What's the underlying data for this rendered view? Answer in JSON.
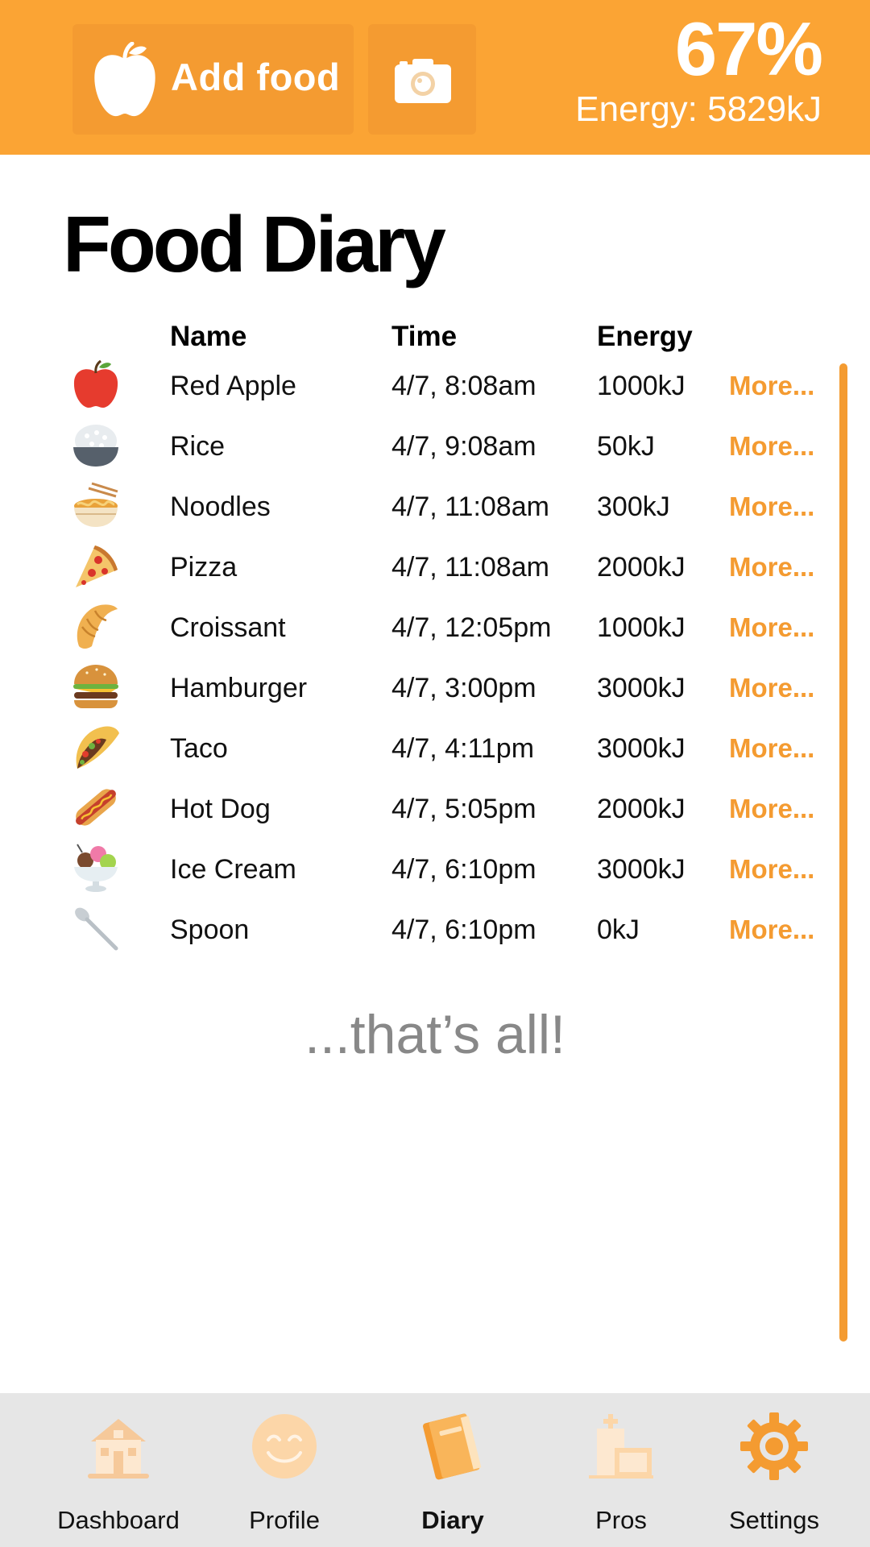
{
  "header": {
    "add_food_label": "Add food",
    "percent": "67%",
    "energy_total": "Energy: 5829kJ",
    "colors": {
      "bar": "#fba434",
      "button": "#f49b31"
    }
  },
  "page_title": "Food Diary",
  "table": {
    "columns": [
      "Name",
      "Time",
      "Energy"
    ],
    "rows": [
      {
        "icon": "red-apple-icon",
        "name": "Red Apple",
        "time": "4/7, 8:08am",
        "energy": "1000kJ",
        "more": "More..."
      },
      {
        "icon": "rice-bowl-icon",
        "name": "Rice",
        "time": "4/7, 9:08am",
        "energy": "50kJ",
        "more": "More..."
      },
      {
        "icon": "noodles-icon",
        "name": "Noodles",
        "time": "4/7, 11:08am",
        "energy": "300kJ",
        "more": "More..."
      },
      {
        "icon": "pizza-icon",
        "name": "Pizza",
        "time": "4/7, 11:08am",
        "energy": "2000kJ",
        "more": "More..."
      },
      {
        "icon": "croissant-icon",
        "name": "Croissant",
        "time": "4/7, 12:05pm",
        "energy": "1000kJ",
        "more": "More..."
      },
      {
        "icon": "hamburger-icon",
        "name": "Hamburger",
        "time": "4/7, 3:00pm",
        "energy": "3000kJ",
        "more": "More..."
      },
      {
        "icon": "taco-icon",
        "name": "Taco",
        "time": "4/7, 4:11pm",
        "energy": "3000kJ",
        "more": "More..."
      },
      {
        "icon": "hot-dog-icon",
        "name": "Hot Dog",
        "time": "4/7, 5:05pm",
        "energy": "2000kJ",
        "more": "More..."
      },
      {
        "icon": "ice-cream-icon",
        "name": "Ice Cream",
        "time": "4/7, 6:10pm",
        "energy": "3000kJ",
        "more": "More..."
      },
      {
        "icon": "spoon-icon",
        "name": "Spoon",
        "time": "4/7, 6:10pm",
        "energy": "0kJ",
        "more": "More..."
      }
    ]
  },
  "end_note": "...that’s all!",
  "tabbar": {
    "tabs": [
      {
        "label": "Dashboard",
        "icon": "house-icon"
      },
      {
        "label": "Profile",
        "icon": "smiley-icon"
      },
      {
        "label": "Diary",
        "icon": "notebook-icon",
        "active": true
      },
      {
        "label": "Pros",
        "icon": "hospital-icon"
      },
      {
        "label": "Settings",
        "icon": "gear-icon"
      }
    ],
    "accent": "#f49b31"
  }
}
